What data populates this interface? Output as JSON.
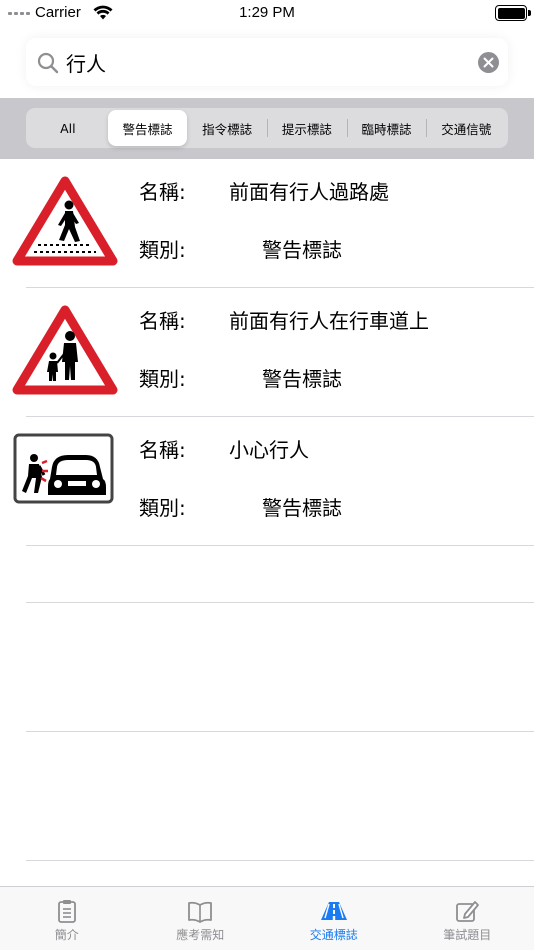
{
  "status_bar": {
    "carrier": "Carrier",
    "time": "1:29 PM"
  },
  "search": {
    "query": "行人"
  },
  "segments": [
    {
      "label": "All",
      "selected": false
    },
    {
      "label": "警告標誌",
      "selected": true
    },
    {
      "label": "指令標誌",
      "selected": false
    },
    {
      "label": "提示標誌",
      "selected": false
    },
    {
      "label": "臨時標誌",
      "selected": false
    },
    {
      "label": "交通信號",
      "selected": false
    }
  ],
  "results": [
    {
      "icon": "pedestrian-crossing-sign-icon",
      "name_label": "名稱:",
      "name": "前面有行人過路處",
      "category_label": "類別:",
      "category": "警告標誌"
    },
    {
      "icon": "pedestrians-on-road-sign-icon",
      "name_label": "名稱:",
      "name": "前面有行人在行車道上",
      "category_label": "類別:",
      "category": "警告標誌"
    },
    {
      "icon": "beware-pedestrian-sign-icon",
      "name_label": "名稱:",
      "name": "小心行人",
      "category_label": "類別:",
      "category": "警告標誌"
    }
  ],
  "tabs": [
    {
      "icon": "clipboard-icon",
      "label": "簡介",
      "selected": false
    },
    {
      "icon": "book-icon",
      "label": "應考需知",
      "selected": false
    },
    {
      "icon": "road-icon",
      "label": "交通標誌",
      "selected": true
    },
    {
      "icon": "edit-icon",
      "label": "筆試題目",
      "selected": false
    }
  ],
  "colors": {
    "accent": "#1a7cf0",
    "sign_red": "#d9202a",
    "segment_background": "#c8c7cc"
  }
}
